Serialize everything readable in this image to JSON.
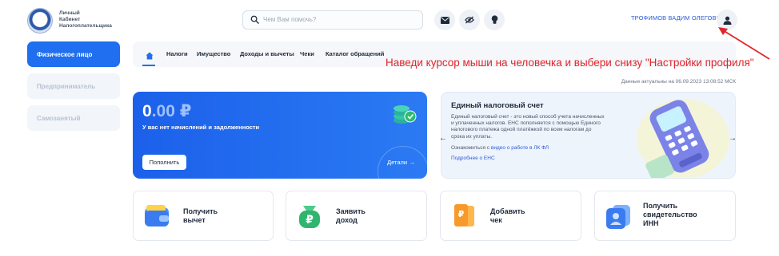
{
  "header": {
    "logo_lines": [
      "Личный",
      "Кабинет",
      "Налогоплательщика"
    ],
    "search_placeholder": "Чем Вам помочь?",
    "icons": [
      "mail-icon",
      "eye-off-icon",
      "lightbulb-icon"
    ],
    "user_name": "ТРОФИМОВ ВАДИМ ОЛЕГОВИЧ",
    "user_icon": "user-icon"
  },
  "sidebar": {
    "items": [
      {
        "label": "Физическое лицо",
        "active": true
      },
      {
        "label": "Предприниматель",
        "active": false
      },
      {
        "label": "Самозанятый",
        "active": false
      }
    ]
  },
  "tabs": [
    "Налоги",
    "Имущество",
    "Доходы и вычеты",
    "Чеки",
    "Каталог обращений"
  ],
  "annotation": "Наведи курсор мыши на человечка и выбери снизу \"Настройки профиля\"",
  "data_actual": "Данные актуальны на 06.09.2023 13:08:52 МСК",
  "balance": {
    "amount_main": "0",
    "amount_cents": ".00",
    "currency": "₽",
    "message": "У вас нет начислений и задолженности",
    "pay_label": "Пополнить",
    "details_label": "Детали"
  },
  "ens": {
    "title": "Единый налоговый счет",
    "description": "Единый налоговый счет - это новый способ учета начисленных и уплаченных налогов. ЕНС пополняется с помощью Единого налогового платежа одной платёжкой по всем налогам до срока их уплаты.",
    "more_prefix": "Ознакомиться с",
    "more_link": "видео о работе в ЛК ФЛ",
    "about_link": "Подробнее о ЕНС"
  },
  "actions": [
    {
      "line1": "Получить",
      "line2": "вычет",
      "line3": "",
      "icon": "wallet-icon"
    },
    {
      "line1": "Заявить",
      "line2": "доход",
      "line3": "",
      "icon": "ruble-bag-icon"
    },
    {
      "line1": "Добавить",
      "line2": "чек",
      "line3": "",
      "icon": "receipt-icon"
    },
    {
      "line1": "Получить",
      "line2": "свидетельство",
      "line3": "ИНН",
      "icon": "id-card-icon"
    }
  ],
  "colors": {
    "accent": "#1f6ff0",
    "annotation": "#e0262a",
    "link": "#2b5dd8"
  }
}
